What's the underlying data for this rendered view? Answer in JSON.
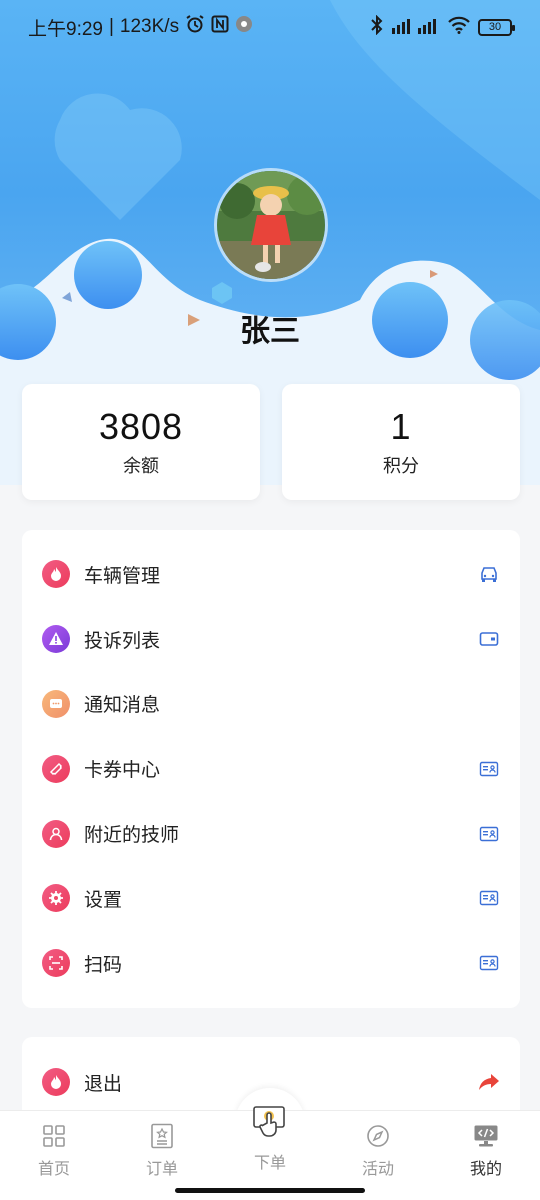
{
  "status": {
    "time": "上午9:29",
    "speed": "123K/s",
    "battery": "30",
    "icons": [
      "alarm-icon",
      "nfc-icon",
      "app-icon",
      "bluetooth-icon",
      "signal-icon",
      "wifi-icon",
      "battery-icon"
    ]
  },
  "profile": {
    "name": "张三"
  },
  "stats": [
    {
      "value": "3808",
      "label": "余额"
    },
    {
      "value": "1",
      "label": "积分"
    }
  ],
  "menu": [
    {
      "label": "车辆管理",
      "icon": "fire-icon",
      "right_icon": "car-icon",
      "color": "#f0506e"
    },
    {
      "label": "投诉列表",
      "icon": "warning-icon",
      "right_icon": "wallet-icon",
      "color": "#9b4de6"
    },
    {
      "label": "通知消息",
      "icon": "chat-icon",
      "right_icon": "",
      "color": "#f5a66a"
    },
    {
      "label": "卡券中心",
      "icon": "ticket-icon",
      "right_icon": "id-card-icon",
      "color": "#f0506e"
    },
    {
      "label": "附近的技师",
      "icon": "person-icon",
      "right_icon": "id-card-icon",
      "color": "#f0506e"
    },
    {
      "label": "设置",
      "icon": "gear-icon",
      "right_icon": "id-card-icon",
      "color": "#f0506e"
    },
    {
      "label": "扫码",
      "icon": "scan-icon",
      "right_icon": "id-card-icon",
      "color": "#f0506e"
    }
  ],
  "logout": {
    "label": "退出",
    "icon": "fire-icon",
    "right_icon": "arrow-share-icon"
  },
  "tabs": [
    {
      "label": "首页",
      "icon": "grid-icon"
    },
    {
      "label": "订单",
      "icon": "order-icon"
    },
    {
      "label": "下单",
      "icon": "hand-tap-icon"
    },
    {
      "label": "活动",
      "icon": "compass-icon"
    },
    {
      "label": "我的",
      "icon": "monitor-code-icon",
      "active": true
    }
  ],
  "colors": {
    "accent": "#4aa5f0",
    "icon_blue": "#3b6fd6",
    "pink": "#f0506e",
    "logout_arrow": "#e8443a"
  }
}
